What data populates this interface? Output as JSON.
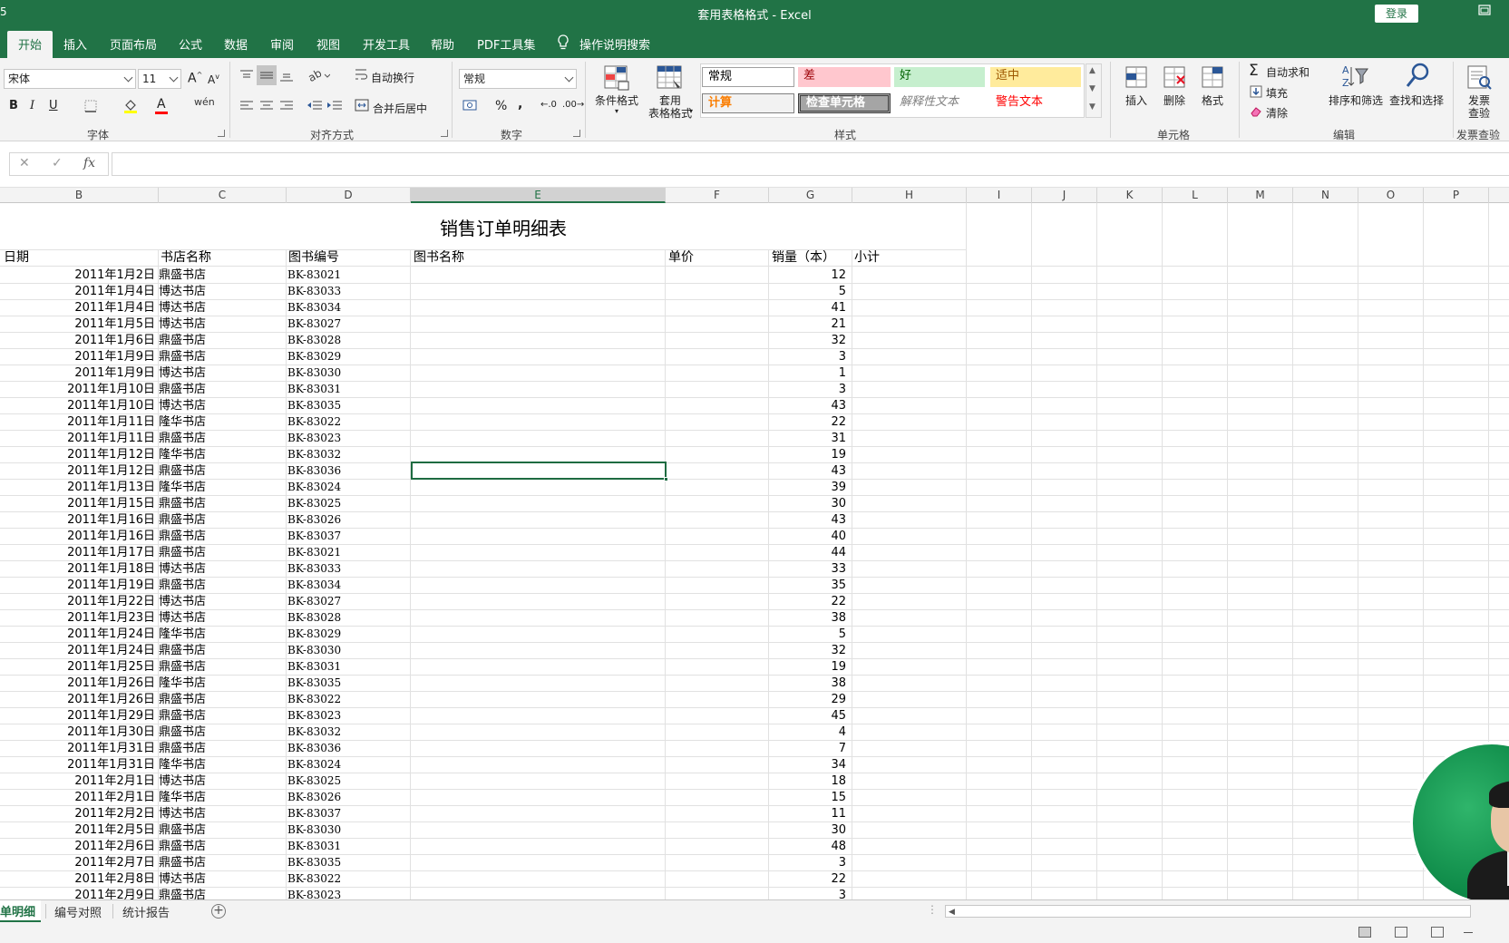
{
  "window": {
    "title": "套用表格格式  -  Excel",
    "login_label": "登录",
    "left_mark": "5"
  },
  "tabs": [
    "开始",
    "插入",
    "页面布局",
    "公式",
    "数据",
    "审阅",
    "视图",
    "开发工具",
    "帮助",
    "PDF工具集"
  ],
  "tell_me": "操作说明搜索",
  "ribbon": {
    "font_name": "宋体",
    "font_size": "11",
    "font_group": "字体",
    "wrap_text": "自动换行",
    "merge_center": "合并后居中",
    "alignment_group": "对齐方式",
    "number_format": "常规",
    "number_group": "数字",
    "percent": "%",
    "comma": ",",
    "cond_format": "条件格式",
    "table_format_line1": "套用",
    "table_format_line2": "表格格式",
    "styles_group": "样式",
    "styles": {
      "normal": "常规",
      "bad": "差",
      "good": "好",
      "neutral": "适中",
      "calc": "计算",
      "check": "检查单元格",
      "explain": "解释性文本",
      "warning": "警告文本"
    },
    "insert": "插入",
    "delete": "删除",
    "format": "格式",
    "cells_group": "单元格",
    "autosum": "自动求和",
    "fill": "填充",
    "clear": "清除",
    "sort_filter": "排序和筛选",
    "find_select": "查找和选择",
    "editing_group": "编辑",
    "invoice_line1": "发票",
    "invoice_line2": "查验",
    "invoice_group": "发票查验",
    "bold": "B",
    "italic": "I",
    "underline": "U",
    "font_color_letter": "A",
    "grow_font": "A",
    "shrink_font": "A"
  },
  "formula": {
    "cancel": "✕",
    "enter": "✓",
    "fx": "fx",
    "value": ""
  },
  "columns": [
    "B",
    "C",
    "D",
    "E",
    "F",
    "G",
    "H",
    "I",
    "J",
    "K",
    "L",
    "M",
    "N",
    "O",
    "P"
  ],
  "sheet": {
    "title": "销售订单明细表",
    "headers": {
      "date": "日期",
      "store": "书店名称",
      "code": "图书编号",
      "name": "图书名称",
      "price": "单价",
      "qty": "销量（本）",
      "subtotal": "小计"
    },
    "rows": [
      [
        "2011年1月2日",
        "鼎盛书店",
        "BK-83021",
        "12"
      ],
      [
        "2011年1月4日",
        "博达书店",
        "BK-83033",
        "5"
      ],
      [
        "2011年1月4日",
        "博达书店",
        "BK-83034",
        "41"
      ],
      [
        "2011年1月5日",
        "博达书店",
        "BK-83027",
        "21"
      ],
      [
        "2011年1月6日",
        "鼎盛书店",
        "BK-83028",
        "32"
      ],
      [
        "2011年1月9日",
        "鼎盛书店",
        "BK-83029",
        "3"
      ],
      [
        "2011年1月9日",
        "博达书店",
        "BK-83030",
        "1"
      ],
      [
        "2011年1月10日",
        "鼎盛书店",
        "BK-83031",
        "3"
      ],
      [
        "2011年1月10日",
        "博达书店",
        "BK-83035",
        "43"
      ],
      [
        "2011年1月11日",
        "隆华书店",
        "BK-83022",
        "22"
      ],
      [
        "2011年1月11日",
        "鼎盛书店",
        "BK-83023",
        "31"
      ],
      [
        "2011年1月12日",
        "隆华书店",
        "BK-83032",
        "19"
      ],
      [
        "2011年1月12日",
        "鼎盛书店",
        "BK-83036",
        "43"
      ],
      [
        "2011年1月13日",
        "隆华书店",
        "BK-83024",
        "39"
      ],
      [
        "2011年1月15日",
        "鼎盛书店",
        "BK-83025",
        "30"
      ],
      [
        "2011年1月16日",
        "鼎盛书店",
        "BK-83026",
        "43"
      ],
      [
        "2011年1月16日",
        "鼎盛书店",
        "BK-83037",
        "40"
      ],
      [
        "2011年1月17日",
        "鼎盛书店",
        "BK-83021",
        "44"
      ],
      [
        "2011年1月18日",
        "博达书店",
        "BK-83033",
        "33"
      ],
      [
        "2011年1月19日",
        "鼎盛书店",
        "BK-83034",
        "35"
      ],
      [
        "2011年1月22日",
        "博达书店",
        "BK-83027",
        "22"
      ],
      [
        "2011年1月23日",
        "博达书店",
        "BK-83028",
        "38"
      ],
      [
        "2011年1月24日",
        "隆华书店",
        "BK-83029",
        "5"
      ],
      [
        "2011年1月24日",
        "鼎盛书店",
        "BK-83030",
        "32"
      ],
      [
        "2011年1月25日",
        "鼎盛书店",
        "BK-83031",
        "19"
      ],
      [
        "2011年1月26日",
        "隆华书店",
        "BK-83035",
        "38"
      ],
      [
        "2011年1月26日",
        "鼎盛书店",
        "BK-83022",
        "29"
      ],
      [
        "2011年1月29日",
        "鼎盛书店",
        "BK-83023",
        "45"
      ],
      [
        "2011年1月30日",
        "鼎盛书店",
        "BK-83032",
        "4"
      ],
      [
        "2011年1月31日",
        "鼎盛书店",
        "BK-83036",
        "7"
      ],
      [
        "2011年1月31日",
        "隆华书店",
        "BK-83024",
        "34"
      ],
      [
        "2011年2月1日",
        "博达书店",
        "BK-83025",
        "18"
      ],
      [
        "2011年2月1日",
        "隆华书店",
        "BK-83026",
        "15"
      ],
      [
        "2011年2月2日",
        "博达书店",
        "BK-83037",
        "11"
      ],
      [
        "2011年2月5日",
        "鼎盛书店",
        "BK-83030",
        "30"
      ],
      [
        "2011年2月6日",
        "鼎盛书店",
        "BK-83031",
        "48"
      ],
      [
        "2011年2月7日",
        "鼎盛书店",
        "BK-83035",
        "3"
      ],
      [
        "2011年2月8日",
        "博达书店",
        "BK-83022",
        "22"
      ],
      [
        "2011年2月9日",
        "鼎盛书店",
        "BK-83023",
        "3"
      ]
    ]
  },
  "sheet_tabs": [
    "单明细",
    "编号对照",
    "统计报告"
  ],
  "colors": {
    "excel_green": "#217346",
    "ribbon_bg": "#f3f3f3",
    "bad_bg": "#ffc7ce",
    "bad_fg": "#9c0006",
    "good_bg": "#c6efce",
    "good_fg": "#006100",
    "neutral_bg": "#ffeb9c",
    "neutral_fg": "#9c5700",
    "calc_fg": "#fa7d00",
    "check_bg": "#a5a5a5",
    "warning_fg": "#ff0000",
    "explain_fg": "#7f7f7f"
  }
}
